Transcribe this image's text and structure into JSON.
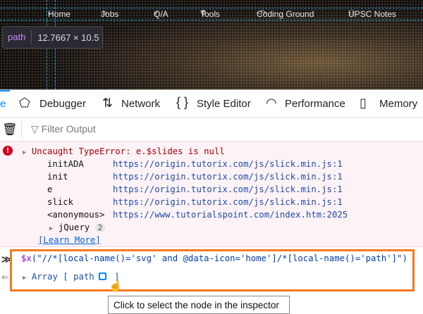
{
  "page_nav": {
    "items": [
      {
        "icon": "home-icon",
        "label": "Home"
      },
      {
        "icon": "briefcase-icon",
        "label": "Jobs"
      },
      {
        "icon": "send-icon",
        "label": "Q/A"
      },
      {
        "icon": "tools-icon",
        "label": "Tools"
      },
      {
        "icon": "code-icon",
        "label": "Coding Ground"
      },
      {
        "icon": "user-icon",
        "label": "UPSC Notes"
      }
    ]
  },
  "highlighter": {
    "tag": "path",
    "dimensions": "12.7667 × 10.5"
  },
  "devtools": {
    "tabs": [
      {
        "label": "e",
        "icon": "console-icon"
      },
      {
        "label": "Debugger",
        "icon": "debugger-icon"
      },
      {
        "label": "Network",
        "icon": "network-icon"
      },
      {
        "label": "Style Editor",
        "icon": "braces-icon"
      },
      {
        "label": "Performance",
        "icon": "gauge-icon"
      },
      {
        "label": "Memory",
        "icon": "memory-icon"
      }
    ],
    "filter_placeholder": "Filter Output"
  },
  "console": {
    "error": {
      "message": "Uncaught TypeError: e.$slides is null",
      "stack": [
        {
          "fn": "initADA",
          "loc": "https://origin.tutorix.com/js/slick.min.js:1"
        },
        {
          "fn": "init",
          "loc": "https://origin.tutorix.com/js/slick.min.js:1"
        },
        {
          "fn": "e",
          "loc": "https://origin.tutorix.com/js/slick.min.js:1"
        },
        {
          "fn": "slick",
          "loc": "https://origin.tutorix.com/js/slick.min.js:1"
        },
        {
          "fn": "<anonymous>",
          "loc": "https://www.tutorialspoint.com/index.htm:2025"
        }
      ],
      "group": "jQuery",
      "group_count": "2",
      "learn_more": "[Learn More]"
    },
    "input_fn": "$x",
    "input_args": "(\"//*[local-name()='svg' and @data-icon='home']/*[local-name()='path']\")",
    "result_prefix": "Array [ path",
    "result_suffix": "]",
    "tooltip": "Click to select the node in the inspector"
  },
  "colors": {
    "highlight_border": "#f47a20",
    "error_bg": "#fdf2f5",
    "accent": "#0a84ff"
  }
}
